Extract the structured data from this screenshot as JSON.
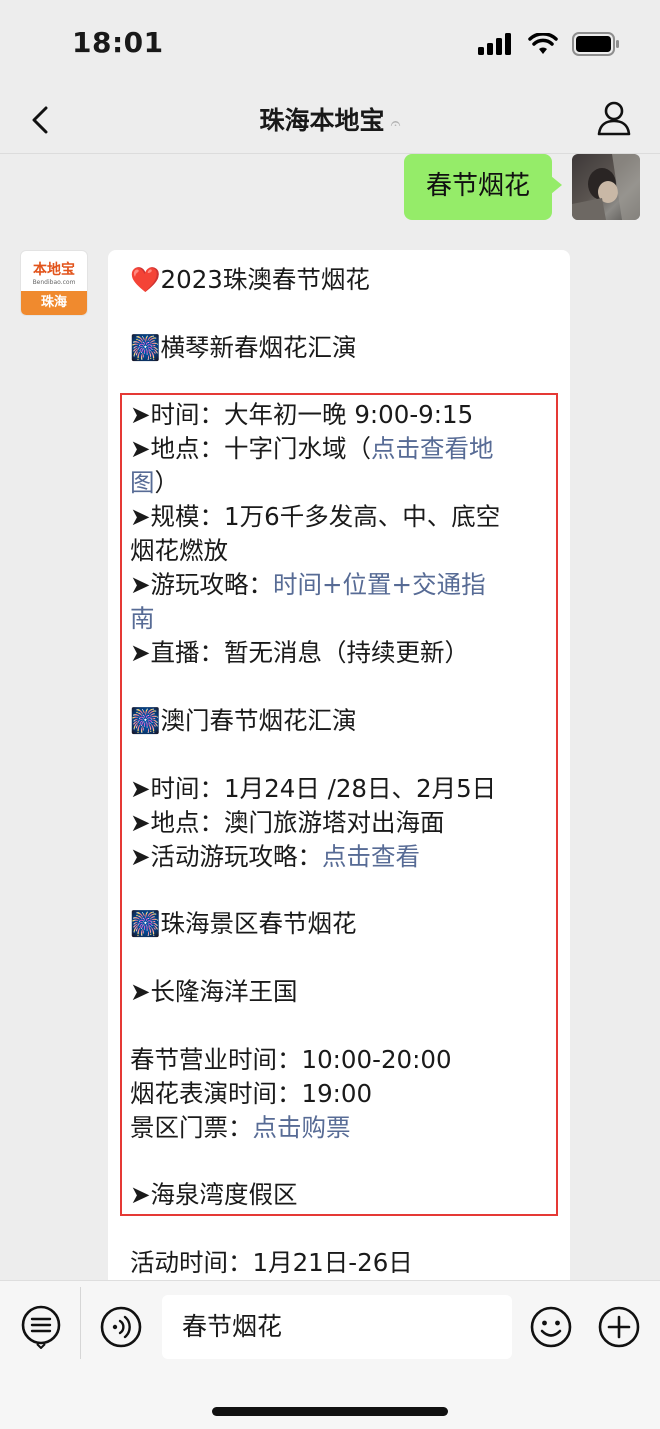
{
  "status_bar": {
    "time": "18:01"
  },
  "nav": {
    "title": "珠海本地宝",
    "ear_icon": "𝄐"
  },
  "sent_message": {
    "text": "春节烟花"
  },
  "bot_avatar": {
    "logo_top": "本地宝",
    "logo_url": "Bendibao.com",
    "logo_bottom": "珠海"
  },
  "message": {
    "lines": [
      {
        "prefix": "❤️",
        "text": "2023珠澳春节烟花"
      },
      {
        "prefix": "🎆",
        "text": "横琴新春烟花汇演"
      },
      {
        "text": "➤时间：大年初一晚 9:00-9:15"
      },
      {
        "text": "➤地点：十字门水域（",
        "link": "点击查看地"
      },
      {
        "link": "图",
        "text": "）"
      },
      {
        "text": "➤规模：1万6千多发高、中、底空"
      },
      {
        "text": "烟花燃放"
      },
      {
        "text": "➤游玩攻略：",
        "link": "时间+位置+交通指"
      },
      {
        "link": "南"
      },
      {
        "text": "➤直播：暂无消息（持续更新）"
      },
      {
        "prefix": "🎆",
        "text": "澳门春节烟花汇演"
      },
      {
        "text": "➤时间：1月24日 /28日、2月5日"
      },
      {
        "text": "➤地点：澳门旅游塔对出海面"
      },
      {
        "text": "➤活动游玩攻略：",
        "link": "点击查看"
      },
      {
        "prefix": "🎆",
        "text": "珠海景区春节烟花"
      },
      {
        "text": "➤长隆海洋王国"
      },
      {
        "text": "春节营业时间：10:00-20:00"
      },
      {
        "text": "烟花表演时间：19:00"
      },
      {
        "text": "景区门票：",
        "link": "点击购票"
      },
      {
        "text": "➤海泉湾度假区"
      },
      {
        "text": "活动时间：1月21日-26日"
      }
    ]
  },
  "input_bar": {
    "value": "春节烟花"
  },
  "colors": {
    "sent_bubble": "#95ec69",
    "link": "#576b95",
    "highlight_box": "#e53935"
  }
}
